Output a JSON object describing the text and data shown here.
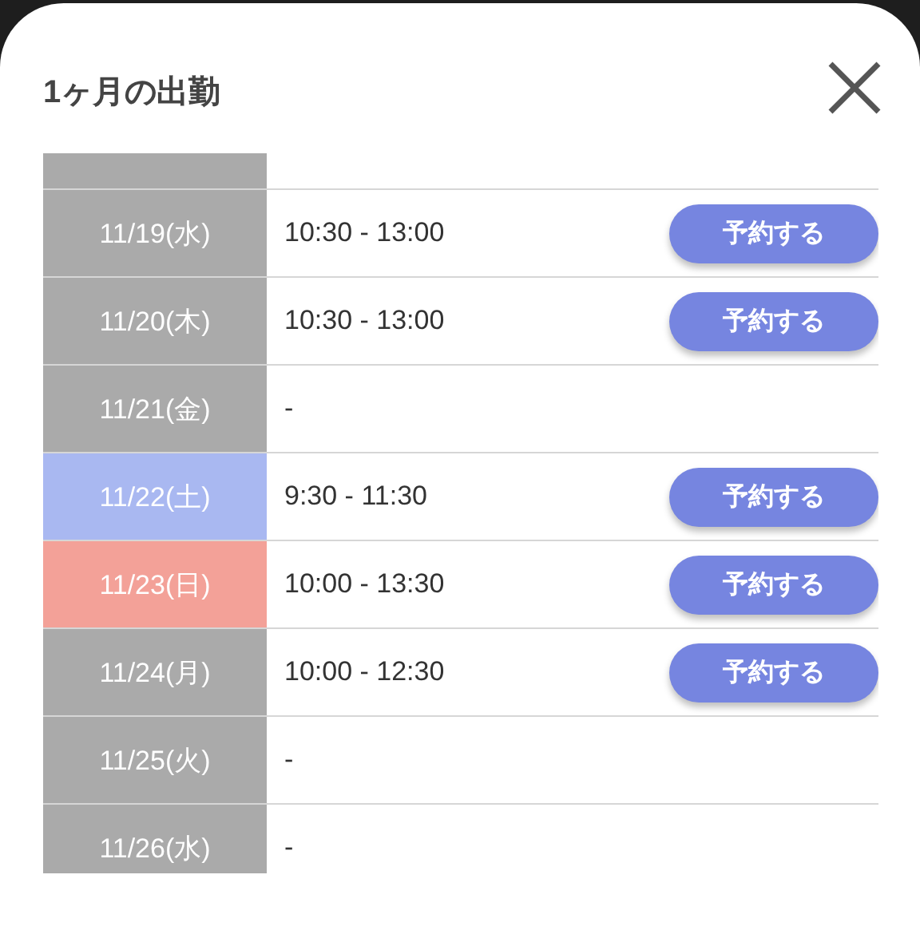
{
  "dialog": {
    "title": "1ヶ月の出勤"
  },
  "table": {
    "top_row_cut": true,
    "rows": [
      {
        "date": "11/19(水)",
        "color": "#aaaaaa",
        "time": "10:30 - 13:00",
        "button": "予約する"
      },
      {
        "date": "11/20(木)",
        "color": "#aaaaaa",
        "time": "10:30 - 13:00",
        "button": "予約する"
      },
      {
        "date": "11/21(金)",
        "color": "#aaaaaa",
        "time": "-"
      },
      {
        "date": "11/22(土)",
        "color": "#a9b8f1",
        "time": "9:30 - 11:30",
        "button": "予約する"
      },
      {
        "date": "11/23(日)",
        "color": "#f3a198",
        "time": "10:00 - 13:30",
        "button": "予約する"
      },
      {
        "date": "11/24(月)",
        "color": "#aaaaaa",
        "time": "10:00 - 12:30",
        "button": "予約する"
      },
      {
        "date": "11/25(火)",
        "color": "#aaaaaa",
        "time": "-"
      },
      {
        "date": "11/26(水)",
        "color": "#aaaaaa",
        "time": "-"
      }
    ]
  }
}
